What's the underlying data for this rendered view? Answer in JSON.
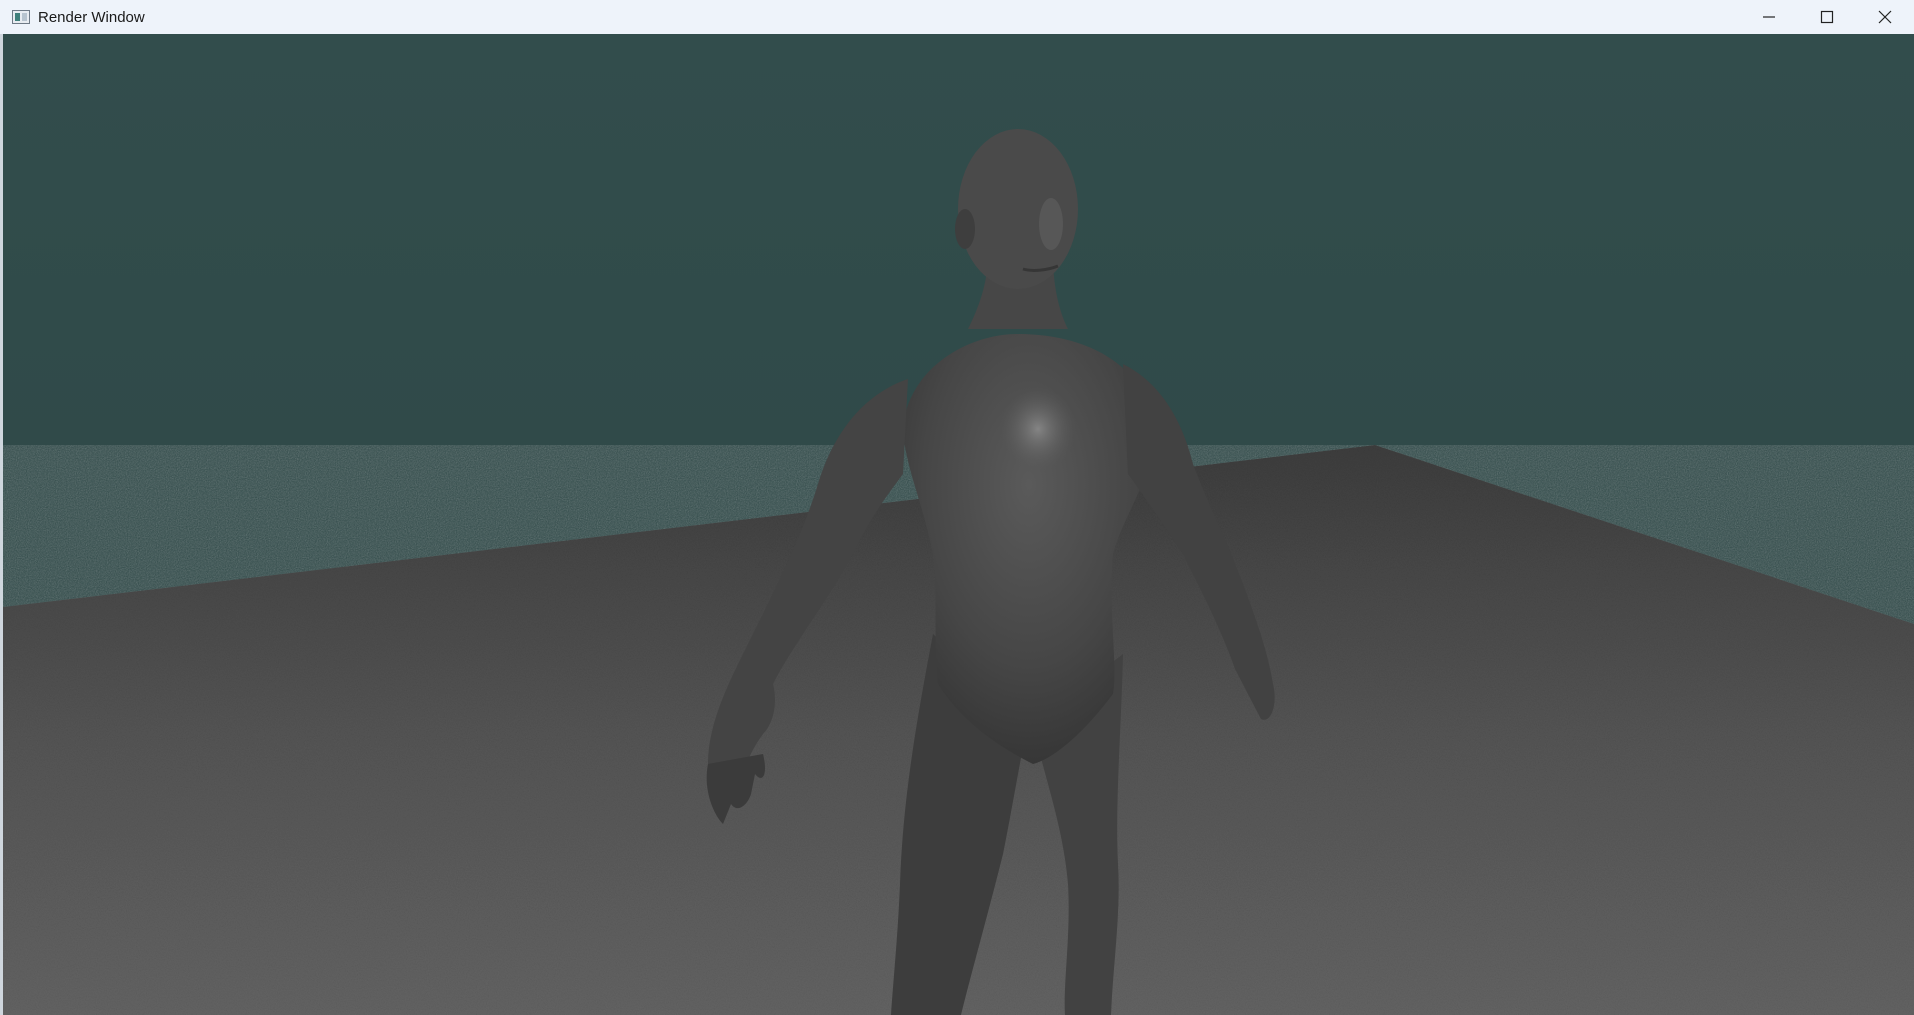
{
  "window": {
    "title": "Render Window",
    "icon": "render-window-app-icon",
    "controls": {
      "minimize_icon": "minimize-icon",
      "maximize_icon": "maximize-icon",
      "close_icon": "close-icon"
    }
  },
  "scene": {
    "background_color": "#2f4b4b",
    "floor_color": "#5a5a5a",
    "model_color": "#4a4a4a",
    "content": "3d-human-model-on-floor-plane"
  }
}
